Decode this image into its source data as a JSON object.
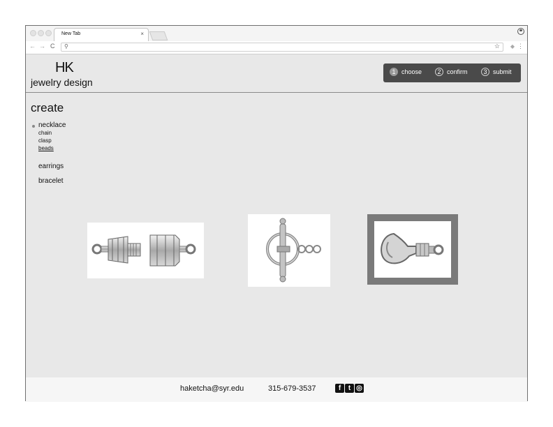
{
  "browser": {
    "tab_title": "New Tab",
    "tab_close": "×",
    "search_glyph": "⚲",
    "bookmark_glyph": "☆",
    "menu_glyph": "⋮",
    "back_glyph": "←",
    "forward_glyph": "→",
    "reload_glyph": "C"
  },
  "header": {
    "logo": "HK",
    "tagline": "jewelry design",
    "steps": [
      {
        "number": "1",
        "label": "choose",
        "active": true
      },
      {
        "number": "2",
        "label": "confirm",
        "active": false
      },
      {
        "number": "3",
        "label": "submit",
        "active": false
      }
    ]
  },
  "sidebar": {
    "heading": "create",
    "items": [
      {
        "label": "necklace",
        "selected": true,
        "sub": [
          "chain",
          "clasp",
          "beads"
        ]
      },
      {
        "label": "earrings"
      },
      {
        "label": "bracelet"
      }
    ]
  },
  "products": [
    {
      "name": "barrel clasp",
      "selected": false
    },
    {
      "name": "toggle clasp",
      "selected": false
    },
    {
      "name": "lobster clasp",
      "selected": true
    }
  ],
  "footer": {
    "email": "haketcha@syr.edu",
    "phone": "315-679-3537",
    "social": [
      "f",
      "t",
      "ig"
    ]
  },
  "colors": {
    "page_bg": "#e8e8e8",
    "step_bar": "#4a4a4a",
    "selected_border": "#7a7a7a",
    "footer_bg": "#f6f6f6"
  }
}
